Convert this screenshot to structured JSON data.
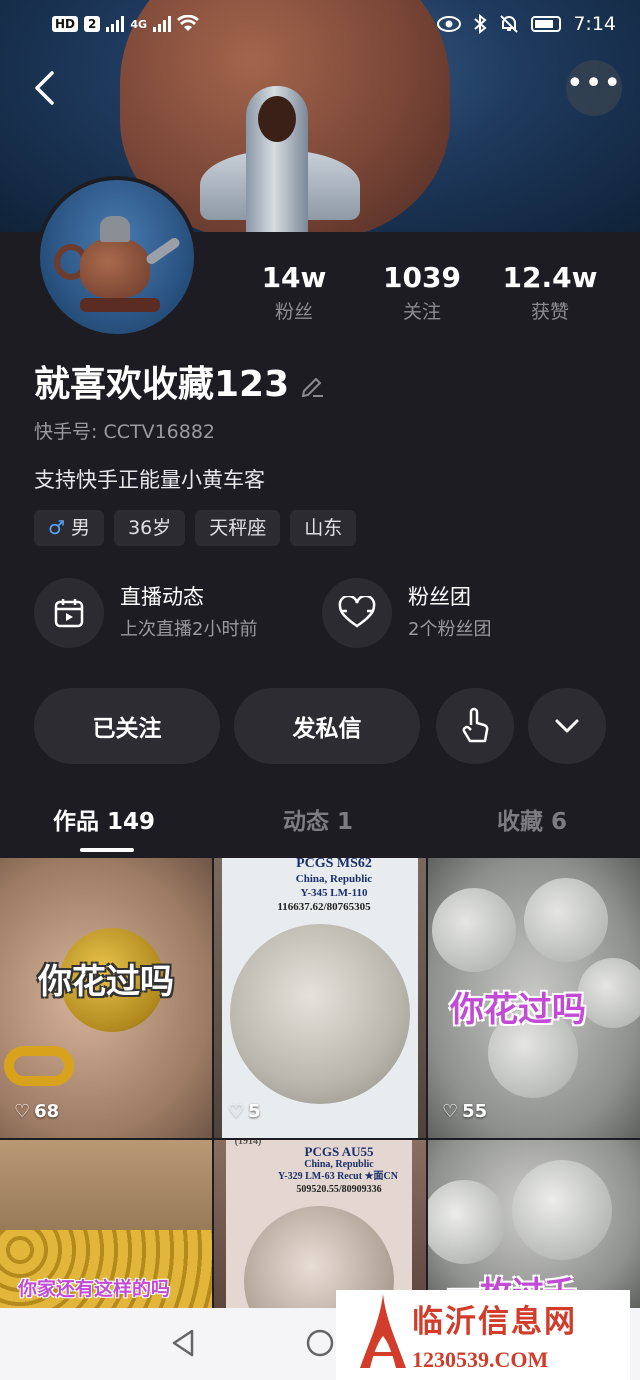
{
  "status_bar": {
    "hd": "HD",
    "sim": "2",
    "network": "4G",
    "time": "7:14"
  },
  "header": {
    "back_icon": "chevron-left-icon",
    "more_label": "•••"
  },
  "profile": {
    "name": "就喜欢收藏123",
    "user_id": "快手号: CCTV16882",
    "bio": "支持快手正能量小黄车客",
    "tags": [
      {
        "icon": "♂",
        "label": "男"
      },
      {
        "label": "36岁"
      },
      {
        "label": "天秤座"
      },
      {
        "label": "山东"
      }
    ]
  },
  "stats": [
    {
      "value": "14w",
      "label": "粉丝"
    },
    {
      "value": "1039",
      "label": "关注"
    },
    {
      "value": "12.4w",
      "label": "获赞"
    }
  ],
  "cards": {
    "live": {
      "title": "直播动态",
      "subtitle": "上次直播2小时前"
    },
    "fans": {
      "title": "粉丝团",
      "subtitle": "2个粉丝团"
    }
  },
  "actions": {
    "follow": "已关注",
    "message": "发私信"
  },
  "tabs": [
    {
      "label": "作品 149"
    },
    {
      "label": "动态 1"
    },
    {
      "label": "收藏 6"
    }
  ],
  "grid": [
    {
      "overlay": "你花过吗",
      "likes": "68"
    },
    {
      "slab": [
        "PCGS MS62",
        "China, Republic",
        "Y-345 LM-110",
        "116637.62/80765305"
      ],
      "likes": "5"
    },
    {
      "overlay": "你花过吗",
      "likes": "55"
    },
    {
      "overlay": "你家还有这样的吗"
    },
    {
      "slab": [
        "(1914)",
        "PCGS AU55",
        "China, Republic",
        "Y-329 LM-63 Recut ★面CN",
        "509520.55/80909336"
      ]
    },
    {
      "overlay": "一枚过千"
    }
  ],
  "watermark": {
    "title": "临沂信息网",
    "url": "1230539.COM"
  },
  "colors": {
    "background": "#1d1c22",
    "chip": "#2c2b32",
    "muted_text": "#8c8b92",
    "male_icon": "#5aa6ff",
    "watermark_red": "#d23c2a"
  }
}
